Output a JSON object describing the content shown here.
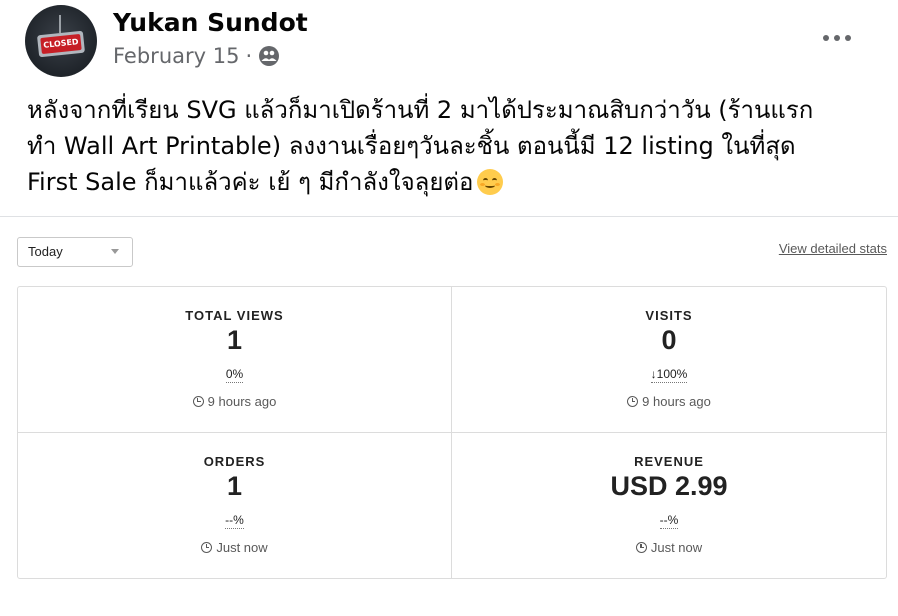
{
  "post": {
    "author": "Yukan Sundot",
    "date": "February 15",
    "separator": "·",
    "privacy_icon": "friends-icon",
    "avatar_text": "CLOSED",
    "text_lines": [
      "หลังจากที่เรียน SVG แล้วก็มาเปิดร้านที่ 2 มาได้ประมาณสิบกว่าวัน (ร้านแรก",
      "ทำ Wall Art Printable) ลงงานเรื่อยๆวันละชิ้น ตอนนี้มี 12 listing ในที่สุด",
      "First Sale ก็มาแล้วค่ะ เย้ ๆ มีกำลังใจลุยต่อ"
    ],
    "emoji": "smiling-face-icon"
  },
  "stats": {
    "period": "Today",
    "detail_link": "View detailed stats",
    "cards": [
      {
        "label": "TOTAL VIEWS",
        "value": "1",
        "change": "0%",
        "time": "9 hours ago"
      },
      {
        "label": "VISITS",
        "value": "0",
        "change": "↓100%",
        "time": "9 hours ago"
      },
      {
        "label": "ORDERS",
        "value": "1",
        "change": "--%",
        "time": "Just now"
      },
      {
        "label": "REVENUE",
        "value": "USD 2.99",
        "change": "--%",
        "time": "Just now"
      }
    ]
  }
}
